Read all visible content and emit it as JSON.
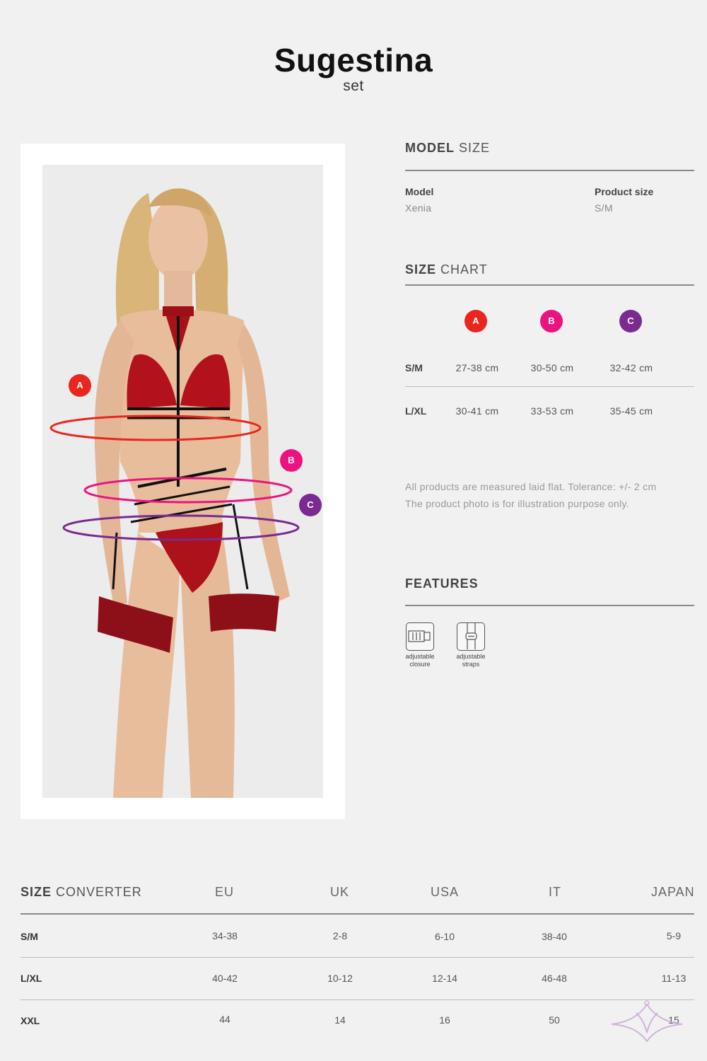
{
  "header": {
    "title": "Sugestina",
    "subtitle": "set"
  },
  "photo": {
    "markers": [
      {
        "letter": "A",
        "color": "#e8261f"
      },
      {
        "letter": "B",
        "color": "#ec1380"
      },
      {
        "letter": "C",
        "color": "#7b2a8f"
      }
    ]
  },
  "model_size": {
    "title_bold": "MODEL",
    "title_rest": "SIZE",
    "model_label": "Model",
    "model_value": "Xenia",
    "size_label": "Product size",
    "size_value": "S/M"
  },
  "size_chart": {
    "title_bold": "SIZE",
    "title_rest": "CHART",
    "columns": [
      {
        "letter": "A",
        "color": "#e8261f"
      },
      {
        "letter": "B",
        "color": "#ec1380"
      },
      {
        "letter": "C",
        "color": "#7b2a8f"
      }
    ],
    "rows": [
      {
        "size": "S/M",
        "a": "27-38 cm",
        "b": "30-50 cm",
        "c": "32-42 cm"
      },
      {
        "size": "L/XL",
        "a": "30-41 cm",
        "b": "33-53 cm",
        "c": "35-45 cm"
      }
    ]
  },
  "notes": {
    "line1": "All products are measured laid flat. Tolerance: +/- 2 cm",
    "line2": "The product photo is for illustration purpose only."
  },
  "features": {
    "title": "FEATURES",
    "items": [
      {
        "icon": "adjustable-closure-icon",
        "line1": "adjustable",
        "line2": "closure"
      },
      {
        "icon": "adjustable-straps-icon",
        "line1": "adjustable",
        "line2": "straps"
      }
    ]
  },
  "converter": {
    "title_bold": "SIZE",
    "title_rest": "CONVERTER",
    "headers": [
      "EU",
      "UK",
      "USA",
      "IT",
      "JAPAN"
    ],
    "rows": [
      {
        "size": "S/M",
        "values": [
          "34-38",
          "2-8",
          "6-10",
          "38-40",
          "5-9"
        ]
      },
      {
        "size": "L/XL",
        "values": [
          "40-42",
          "10-12",
          "12-14",
          "46-48",
          "11-13"
        ]
      },
      {
        "size": "XXL",
        "values": [
          "44",
          "14",
          "16",
          "50",
          "15"
        ]
      }
    ]
  }
}
